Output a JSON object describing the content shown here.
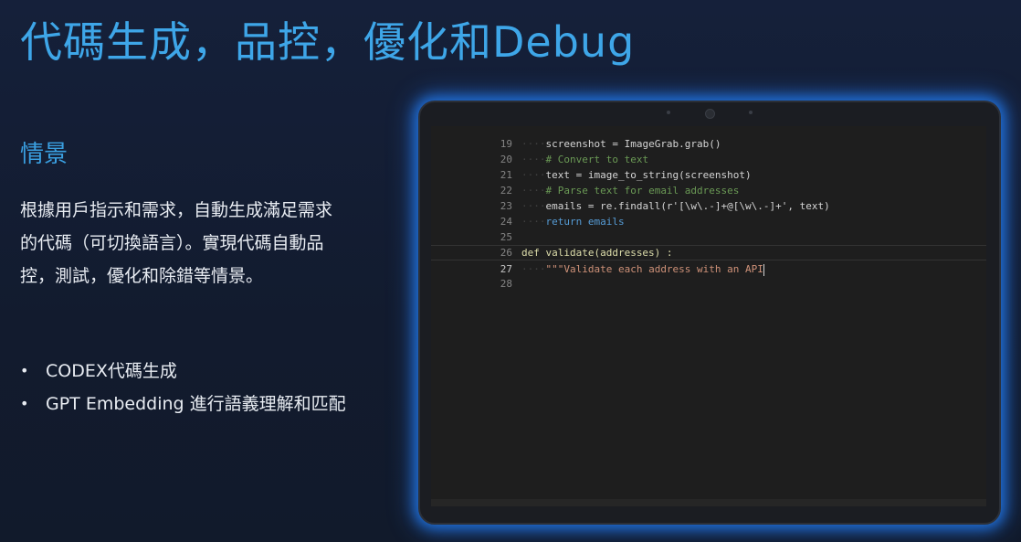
{
  "slide": {
    "title": "代碼生成，品控，優化和Debug",
    "subtitle": "情景",
    "body": "根據用戶指示和需求，自動生成滿足需求的代碼（可切換語言）。實現代碼自動品控，測試，優化和除錯等情景。",
    "bullets": [
      "CODEX代碼生成",
      "GPT Embedding 進行語義理解和匹配"
    ]
  },
  "editor": {
    "lines": [
      {
        "num": "19",
        "indent": "····",
        "code": "screenshot = ImageGrab.grab()"
      },
      {
        "num": "20",
        "indent": "····",
        "code": "# Convert to text"
      },
      {
        "num": "21",
        "indent": "····",
        "code": "text = image_to_string(screenshot)"
      },
      {
        "num": "22",
        "indent": "····",
        "code": "# Parse text for email addresses"
      },
      {
        "num": "23",
        "indent": "····",
        "code": "emails = re.findall(r'[\\w\\.-]+@[\\w\\.-]+', text)"
      },
      {
        "num": "24",
        "indent": "····",
        "code": "return emails"
      },
      {
        "num": "25",
        "indent": "",
        "code": ""
      },
      {
        "num": "26",
        "indent": "",
        "code": "def validate(addresses) :"
      },
      {
        "num": "27",
        "indent": "····",
        "code": "\"\"\"Validate each address with an API"
      },
      {
        "num": "28",
        "indent": "",
        "code": ""
      }
    ],
    "active_line": "27"
  },
  "colors": {
    "title": "#3ea6e8",
    "subtitle": "#3a9fe0",
    "text": "#e8ecf2",
    "background": "#131c2e",
    "glow": "#1f6fd8"
  }
}
